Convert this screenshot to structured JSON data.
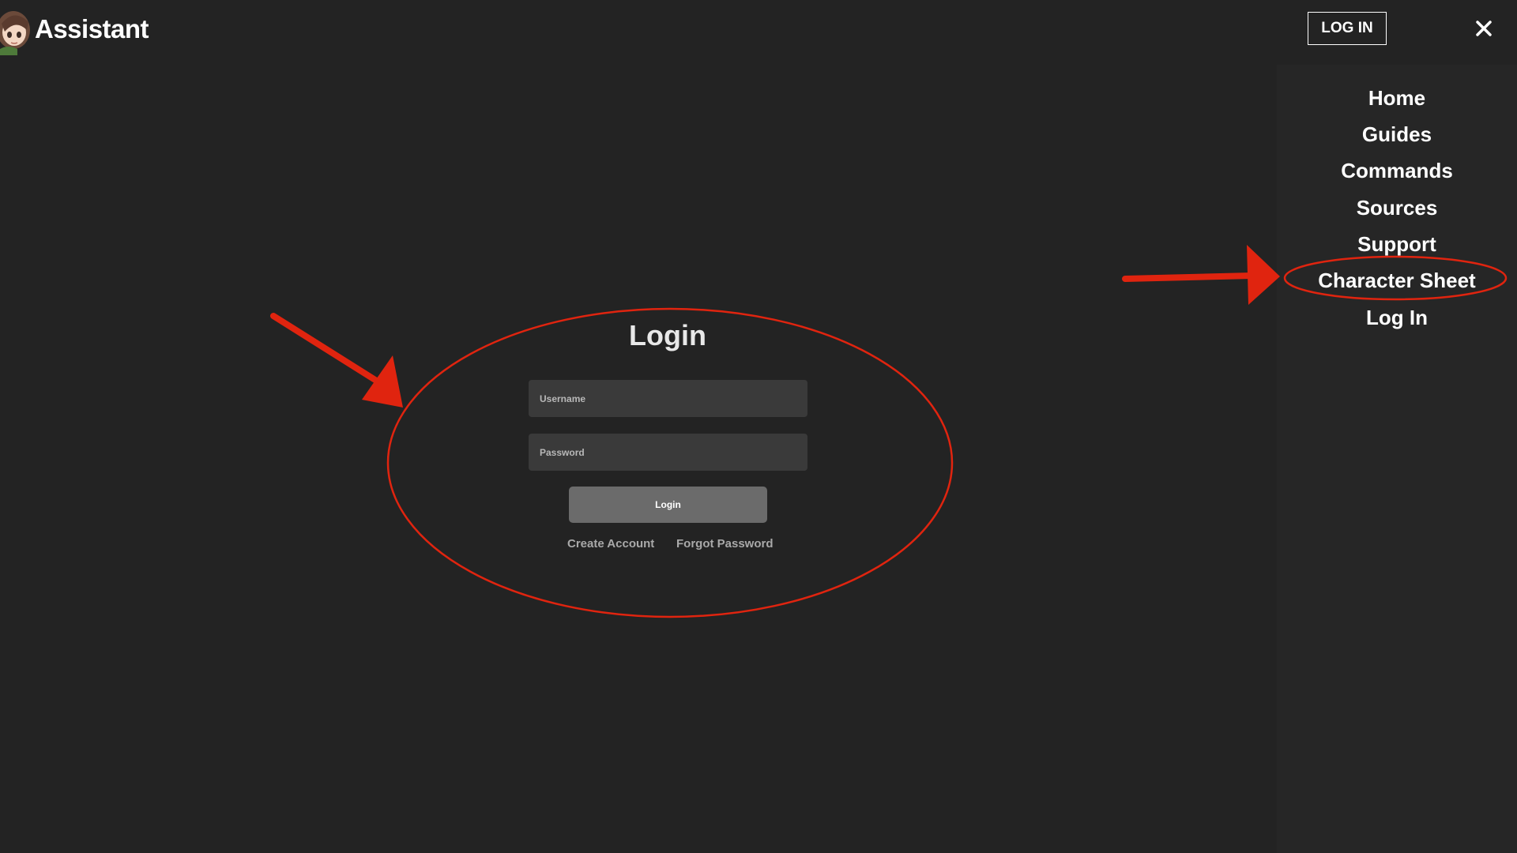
{
  "header": {
    "brand_title": "Assistant",
    "login_button": "LOG IN",
    "close_icon": "close-icon"
  },
  "sidebar": {
    "items": [
      {
        "label": "Home"
      },
      {
        "label": "Guides"
      },
      {
        "label": "Commands"
      },
      {
        "label": "Sources"
      },
      {
        "label": "Support"
      },
      {
        "label": "Character Sheet"
      },
      {
        "label": "Log In"
      }
    ]
  },
  "login": {
    "title": "Login",
    "username_placeholder": "Username",
    "password_placeholder": "Password",
    "submit_label": "Login",
    "create_account": "Create Account",
    "forgot_password": "Forgot Password"
  },
  "colors": {
    "background": "#232323",
    "sidebar": "#262626",
    "input": "#3a3a3a",
    "button": "#6b6b6b",
    "annotation": "#e0240f"
  }
}
